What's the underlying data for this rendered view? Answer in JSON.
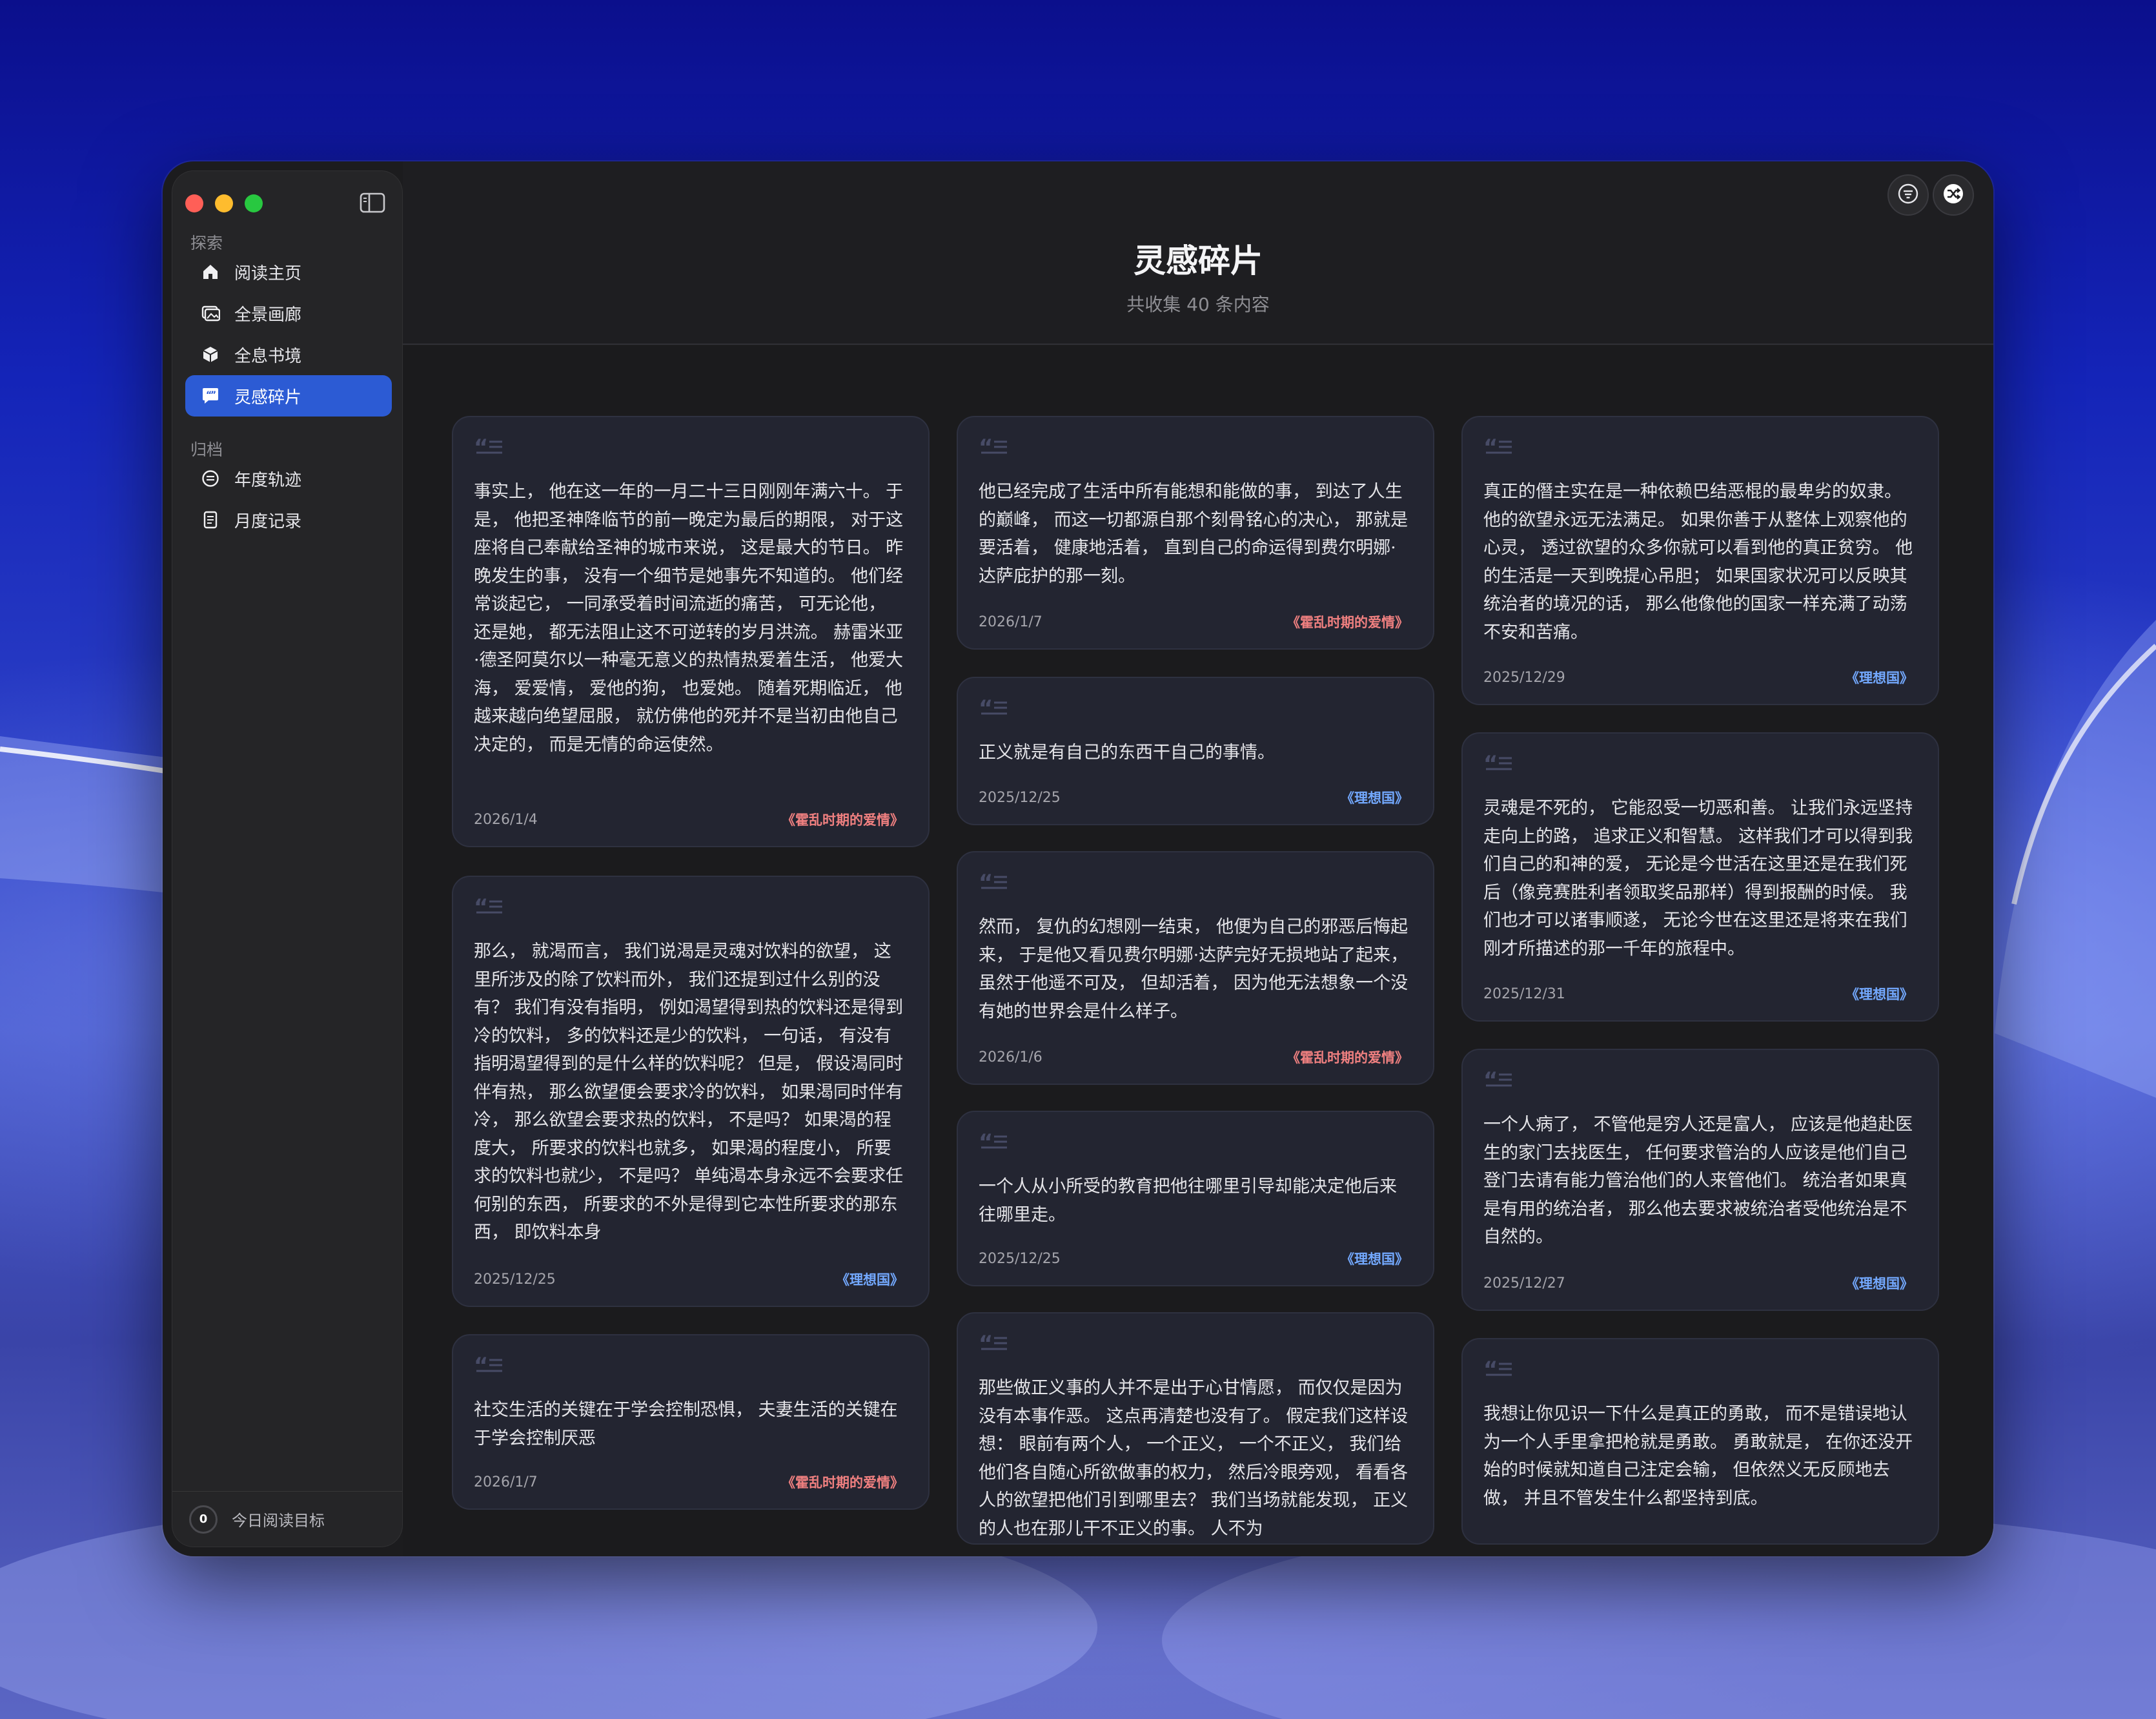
{
  "sidebar": {
    "section_explore": "探索",
    "section_archive": "归档",
    "items": [
      {
        "label": "阅读主页",
        "icon": "house-icon"
      },
      {
        "label": "全景画廊",
        "icon": "gallery-icon"
      },
      {
        "label": "全息书境",
        "icon": "cube-icon"
      },
      {
        "label": "灵感碎片",
        "icon": "quote-bubble-icon",
        "active": true
      },
      {
        "label": "年度轨迹",
        "icon": "calendar-circle-icon"
      },
      {
        "label": "月度记录",
        "icon": "document-icon"
      }
    ],
    "footer": {
      "goal_value": "0",
      "label": "今日阅读目标"
    }
  },
  "header": {
    "title": "灵感碎片",
    "subtitle": "共收集 40 条内容"
  },
  "colors": {
    "accent": "#2c5bd4",
    "source_pink": "#f08080",
    "source_blue": "#73a9ff"
  },
  "cards": {
    "col1": [
      {
        "text": "事实上， 他在这一年的一月二十三日刚刚年满六十。 于是， 他把圣神降临节的前一晚定为最后的期限， 对于这座将自己奉献给圣神的城市来说， 这是最大的节日。 昨晚发生的事， 没有一个细节是她事先不知道的。 他们经常谈起它， 一同承受着时间流逝的痛苦， 可无论他， 还是她， 都无法阻止这不可逆转的岁月洪流。 赫雷米亚·德圣阿莫尔以一种毫无意义的热情热爱着生活， 他爱大海， 爱爱情， 爱他的狗， 也爱她。 随着死期临近， 他越来越向绝望屈服， 就仿佛他的死并不是当初由他自己决定的， 而是无情的命运使然。",
        "date": "2026/1/4",
        "source": "《霍乱时期的爱情》"
      },
      {
        "text": "那么， 就渴而言， 我们说渴是灵魂对饮料的欲望， 这里所涉及的除了饮料而外， 我们还提到过什么别的没有？ 我们有没有指明， 例如渴望得到热的饮料还是得到冷的饮料， 多的饮料还是少的饮料， 一句话， 有没有指明渴望得到的是什么样的饮料呢？ 但是， 假设渴同时伴有热， 那么欲望便会要求冷的饮料， 如果渴同时伴有冷， 那么欲望会要求热的饮料， 不是吗？ 如果渴的程度大， 所要求的饮料也就多， 如果渴的程度小， 所要求的饮料也就少， 不是吗？ 单纯渴本身永远不会要求任何别的东西， 所要求的不外是得到它本性所要求的那东西， 即饮料本身",
        "date": "2025/12/25",
        "source": "《理想国》"
      },
      {
        "text": "社交生活的关键在于学会控制恐惧， 夫妻生活的关键在于学会控制厌恶",
        "date": "2026/1/7",
        "source": "《霍乱时期的爱情》"
      }
    ],
    "col2": [
      {
        "text": "他已经完成了生活中所有能想和能做的事， 到达了人生的巅峰， 而这一切都源自那个刻骨铭心的决心， 那就是要活着， 健康地活着， 直到自己的命运得到费尔明娜·达萨庇护的那一刻。",
        "date": "2026/1/7",
        "source": "《霍乱时期的爱情》"
      },
      {
        "text": "正义就是有自己的东西干自己的事情。",
        "date": "2025/12/25",
        "source": "《理想国》"
      },
      {
        "text": "然而， 复仇的幻想刚一结束， 他便为自己的邪恶后悔起来， 于是他又看见费尔明娜·达萨完好无损地站了起来， 虽然于他遥不可及， 但却活着， 因为他无法想象一个没有她的世界会是什么样子。",
        "date": "2026/1/6",
        "source": "《霍乱时期的爱情》"
      },
      {
        "text": "一个人从小所受的教育把他往哪里引导却能决定他后来往哪里走。",
        "date": "2025/12/25",
        "source": "《理想国》"
      },
      {
        "text": "那些做正义事的人并不是出于心甘情愿， 而仅仅是因为没有本事作恶。 这点再清楚也没有了。 假定我们这样设想： 眼前有两个人， 一个正义， 一个不正义， 我们给他们各自随心所欲做事的权力， 然后冷眼旁观， 看看各人的欲望把他们引到哪里去？ 我们当场就能发现， 正义的人也在那儿干不正义的事。 人不为",
        "date": "",
        "source": ""
      }
    ],
    "col3": [
      {
        "text": "真正的僭主实在是一种依赖巴结恶棍的最卑劣的奴隶。 他的欲望永远无法满足。 如果你善于从整体上观察他的心灵， 透过欲望的众多你就可以看到他的真正贫穷。 他的生活是一天到晚提心吊胆； 如果国家状况可以反映其统治者的境况的话， 那么他像他的国家一样充满了动荡不安和苦痛。",
        "date": "2025/12/29",
        "source": "《理想国》"
      },
      {
        "text": "灵魂是不死的， 它能忍受一切恶和善。 让我们永远坚持走向上的路， 追求正义和智慧。 这样我们才可以得到我们自己的和神的爱， 无论是今世活在这里还是在我们死后（像竞赛胜利者领取奖品那样）得到报酬的时候。 我们也才可以诸事顺遂， 无论今世在这里还是将来在我们刚才所描述的那一千年的旅程中。",
        "date": "2025/12/31",
        "source": "《理想国》"
      },
      {
        "text": "一个人病了， 不管他是穷人还是富人， 应该是他趋赴医生的家门去找医生， 任何要求管治的人应该是他们自己登门去请有能力管治他们的人来管他们。 统治者如果真是有用的统治者， 那么他去要求被统治者受他统治是不自然的。",
        "date": "2025/12/27",
        "source": "《理想国》"
      },
      {
        "text": "我想让你见识一下什么是真正的勇敢， 而不是错误地认为一个人手里拿把枪就是勇敢。 勇敢就是， 在你还没开始的时候就知道自己注定会输， 但依然义无反顾地去做， 并且不管发生什么都坚持到底。",
        "date": "",
        "source": ""
      }
    ]
  }
}
